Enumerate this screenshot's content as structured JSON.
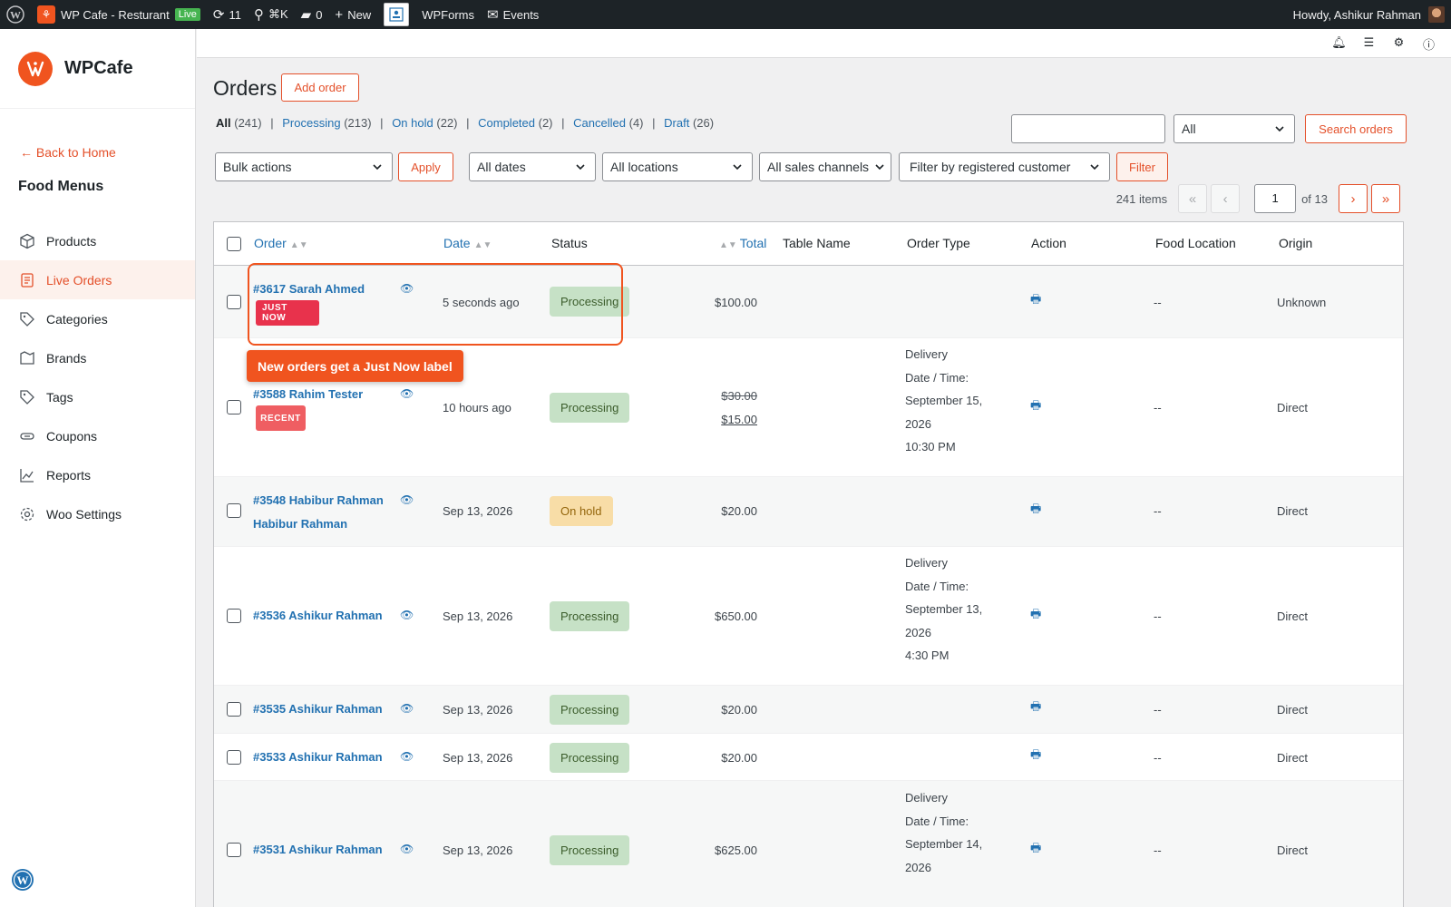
{
  "adminbar": {
    "site_name": "WP Cafe - Resturant",
    "live_label": "Live",
    "updates_count": "11",
    "search_shortcut": "⌘K",
    "comments_count": "0",
    "new_label": "New",
    "wpforms_label": "WPForms",
    "events_label": "Events",
    "howdy": "Howdy, Ashikur Rahman"
  },
  "sidebar": {
    "brand": "WPCafe",
    "back_home": "Back to Home",
    "section_title": "Food Menus",
    "items": [
      {
        "label": "Products",
        "icon": "cube-icon",
        "active": false
      },
      {
        "label": "Live Orders",
        "icon": "clipboard-icon",
        "active": true
      },
      {
        "label": "Categories",
        "icon": "tag-icon",
        "active": false
      },
      {
        "label": "Brands",
        "icon": "flag-icon",
        "active": false
      },
      {
        "label": "Tags",
        "icon": "tag-icon",
        "active": false
      },
      {
        "label": "Coupons",
        "icon": "coupon-icon",
        "active": false
      },
      {
        "label": "Reports",
        "icon": "chart-icon",
        "active": false
      },
      {
        "label": "Woo Settings",
        "icon": "gear-icon",
        "active": false
      }
    ]
  },
  "main": {
    "title": "Orders",
    "add_order": "Add order",
    "status_filters": [
      {
        "label": "All",
        "count": "(241)"
      },
      {
        "label": "Processing",
        "count": "(213)"
      },
      {
        "label": "On hold",
        "count": "(22)"
      },
      {
        "label": "Completed",
        "count": "(2)"
      },
      {
        "label": "Cancelled",
        "count": "(4)"
      },
      {
        "label": "Draft",
        "count": "(26)"
      }
    ],
    "search_status_value": "All",
    "search_button": "Search orders",
    "bulk_actions": "Bulk actions",
    "apply": "Apply",
    "all_dates": "All dates",
    "all_locations": "All locations",
    "all_channels": "All sales channels",
    "customer_filter": "Filter by registered customer",
    "filter_button": "Filter",
    "items_count": "241 items",
    "current_page": "1",
    "of_pages": "of 13"
  },
  "table": {
    "headers": {
      "order": "Order",
      "date": "Date",
      "status": "Status",
      "total": "Total",
      "table_name": "Table Name",
      "order_type": "Order Type",
      "action": "Action",
      "food_location": "Food Location",
      "origin": "Origin"
    },
    "rows": [
      {
        "order": "#3617 Sarah Ahmed",
        "badge": "JUST NOW",
        "date": "5 seconds ago",
        "status": "Processing",
        "total": "$100.00",
        "order_type": [],
        "food_location": "--",
        "origin": "Unknown"
      },
      {
        "order": "#3588 Rahim Tester",
        "badge": "RECENT",
        "date": "10 hours ago",
        "status": "Processing",
        "total_old": "$30.00",
        "total": "$15.00",
        "order_type": [
          "Delivery",
          "Date / Time:",
          "September 15,",
          "2026",
          "10:30 PM"
        ],
        "food_location": "--",
        "origin": "Direct"
      },
      {
        "order": "#3548 Habibur Rahman",
        "order_line2": "Habibur Rahman",
        "date": "Sep 13, 2026",
        "status": "On hold",
        "total": "$20.00",
        "order_type": [],
        "food_location": "--",
        "origin": "Direct"
      },
      {
        "order": "#3536 Ashikur Rahman",
        "date": "Sep 13, 2026",
        "status": "Processing",
        "total": "$650.00",
        "order_type": [
          "Delivery",
          "Date / Time:",
          "September 13,",
          "2026",
          "4:30 PM"
        ],
        "food_location": "--",
        "origin": "Direct"
      },
      {
        "order": "#3535 Ashikur Rahman",
        "date": "Sep 13, 2026",
        "status": "Processing",
        "total": "$20.00",
        "order_type": [],
        "food_location": "--",
        "origin": "Direct"
      },
      {
        "order": "#3533 Ashikur Rahman",
        "date": "Sep 13, 2026",
        "status": "Processing",
        "total": "$20.00",
        "order_type": [],
        "food_location": "--",
        "origin": "Direct"
      },
      {
        "order": "#3531 Ashikur Rahman",
        "date": "Sep 13, 2026",
        "status": "Processing",
        "total": "$625.00",
        "order_type": [
          "Delivery",
          "Date / Time:",
          "September 14,",
          "2026"
        ],
        "food_location": "--",
        "origin": "Direct"
      }
    ]
  },
  "annotation": {
    "callout": "New orders get a Just Now label"
  },
  "colors": {
    "accent": "#e4502a",
    "link": "#2271b1",
    "processing_bg": "#c6e1c6",
    "onhold_bg": "#f8dda7",
    "just_now": "#e8324c",
    "recent": "#ef5e62"
  }
}
